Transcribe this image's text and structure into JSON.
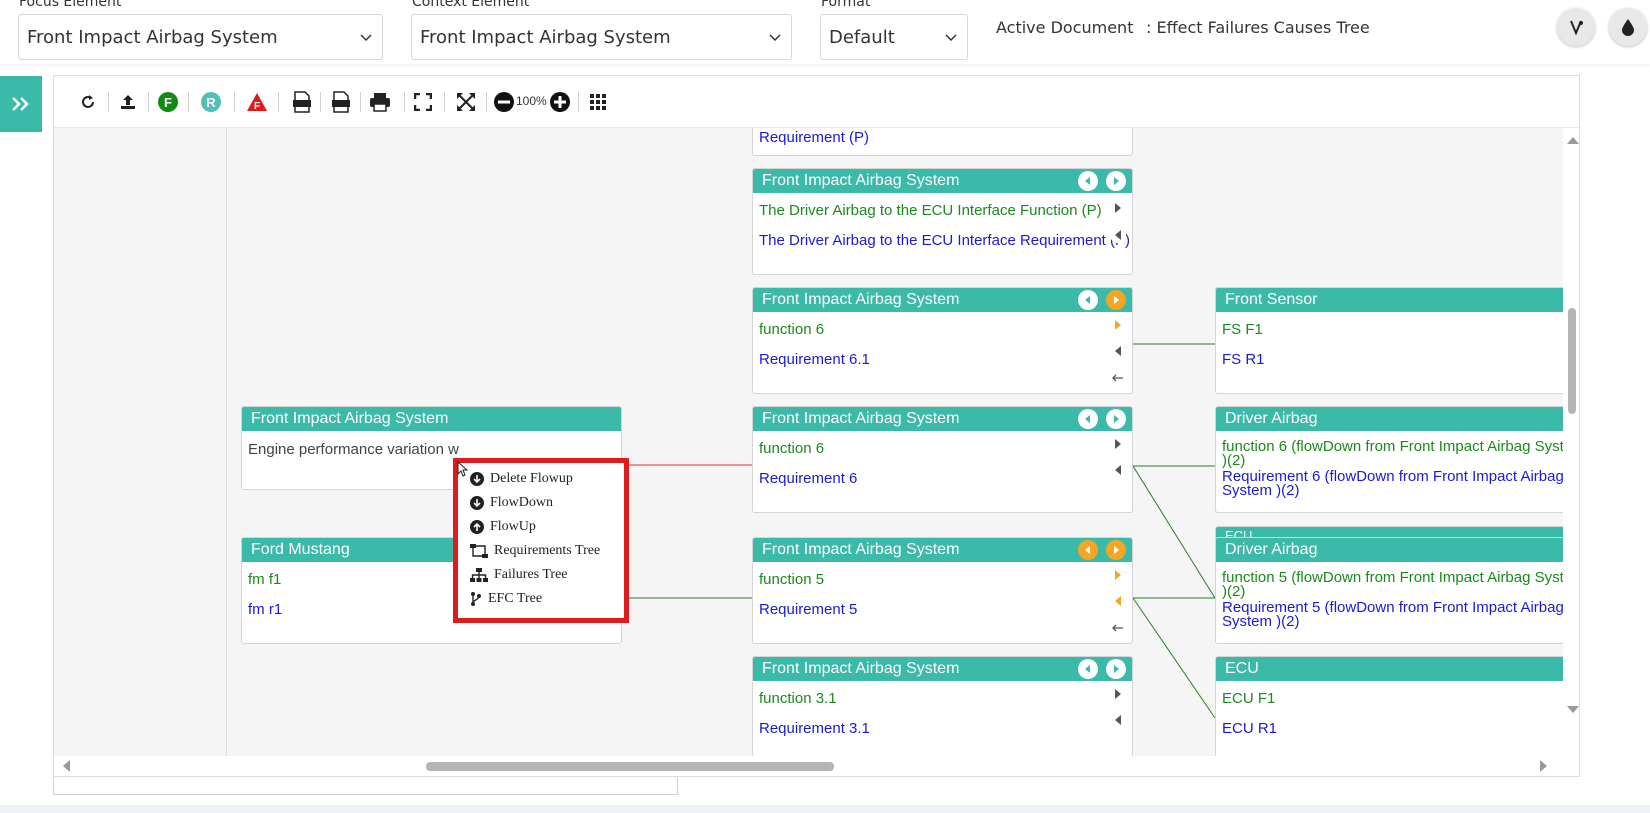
{
  "header": {
    "focus": {
      "label": "Focus Element",
      "value": "Front Impact Airbag System"
    },
    "context": {
      "label": "Context Element",
      "value": "Front Impact Airbag System"
    },
    "format": {
      "label": "Format",
      "value": "Default"
    },
    "active_doc_label": "Active Document",
    "active_doc_value": ": Effect Failures Causes Tree"
  },
  "toolbar": {
    "zoom": "100%",
    "icons": [
      "refresh-icon",
      "upload-icon",
      "function-icon",
      "requirement-icon",
      "failure-icon",
      "svg-export-icon",
      "png-export-icon",
      "print-icon",
      "fit-screen-icon",
      "expand-icon",
      "zoom-out-icon",
      "zoom-in-icon",
      "grid-icon"
    ],
    "f_letter": "F",
    "r_letter": "R"
  },
  "nodes": {
    "top_partial": {
      "row": "Requirement (P)"
    },
    "n1": {
      "title": "Front Impact Airbag System",
      "row1": "The Driver Airbag to the ECU Interface Function (P)",
      "row2": "The Driver Airbag to the ECU Interface Requirement (P)"
    },
    "n2": {
      "title": "Front Impact Airbag System",
      "row1": "function 6",
      "row2": "Requirement 6.1"
    },
    "n3": {
      "title": "Front Impact Airbag System",
      "row1": "function 6",
      "row2": "Requirement 6"
    },
    "n4": {
      "title": "Front Impact Airbag System",
      "row1": "function 5",
      "row2": "Requirement 5"
    },
    "n5": {
      "title": "Front Impact Airbag System",
      "row1": "function 3.1",
      "row2": "Requirement 3.1"
    },
    "left_top": {
      "title": "Front Impact Airbag System",
      "row1": "Engine performance variation w"
    },
    "left_bottom": {
      "title": "Ford Mustang",
      "row1": "fm f1",
      "row2": "fm r1"
    },
    "r1": {
      "title": "Front  Sensor",
      "row1": "FS F1",
      "row2": "FS R1"
    },
    "r2": {
      "title": "Driver Airbag",
      "row1a": "function 6 (flowDown from Front Impact Airbag Syst",
      "row1b": ")(2)",
      "row2a": "Requirement 6 (flowDown from Front Impact Airbag",
      "row2b": "System )(2)"
    },
    "r2_hidden": {
      "title": "ECU"
    },
    "r3": {
      "title": "Driver Airbag",
      "row1a": "function 5 (flowDown from Front Impact Airbag Syst",
      "row1b": ")(2)",
      "row2a": "Requirement 5 (flowDown from Front Impact Airbag",
      "row2b": "System )(2)"
    },
    "r4": {
      "title": "ECU",
      "row1": "ECU F1",
      "row2": "ECU R1"
    }
  },
  "context_menu": {
    "items": [
      "Delete Flowup",
      "FlowDown",
      "FlowUp",
      "Requirements Tree",
      "Failures Tree",
      "EFC Tree"
    ]
  },
  "colors": {
    "accent": "#3bb9a9",
    "function": "#1a8a1a",
    "requirement": "#1a1ad6",
    "menu_border": "#e01b1b"
  }
}
